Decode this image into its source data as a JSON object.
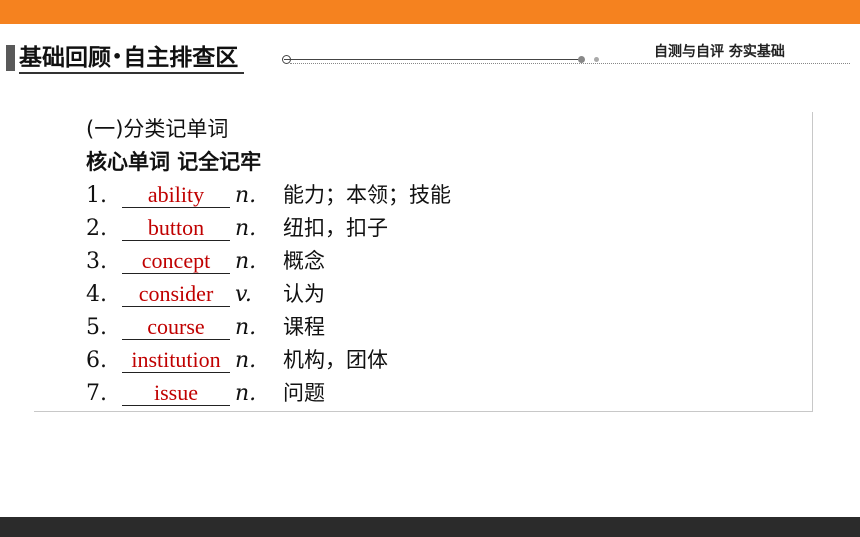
{
  "header": {
    "title_main": "基础回顾",
    "title_sep": "•",
    "title_sub": "自主排查区",
    "subtitle": "自测与自评   夯实基础"
  },
  "section": {
    "heading": "(一)分类记单词",
    "subheading": "核心单词   记全记牢"
  },
  "entries": [
    {
      "number": "1.",
      "word": "ability",
      "pos": "n.",
      "meaning": "能力；本领；技能"
    },
    {
      "number": "2.",
      "word": "button",
      "pos": "n.",
      "meaning": "纽扣，扣子"
    },
    {
      "number": "3.",
      "word": "concept",
      "pos": "n.",
      "meaning": "概念"
    },
    {
      "number": "4.",
      "word": "consider",
      "pos": "v.",
      "meaning": "认为"
    },
    {
      "number": "5.",
      "word": "course",
      "pos": "n.",
      "meaning": "课程"
    },
    {
      "number": "6.",
      "word": "institution",
      "pos": "n.",
      "meaning": "机构，团体"
    },
    {
      "number": "7.",
      "word": "issue",
      "pos": "n.",
      "meaning": "问题"
    }
  ],
  "colors": {
    "accent_orange": "#f5821f",
    "answer_red": "#c00000",
    "footer_dark": "#2b2b2b"
  }
}
